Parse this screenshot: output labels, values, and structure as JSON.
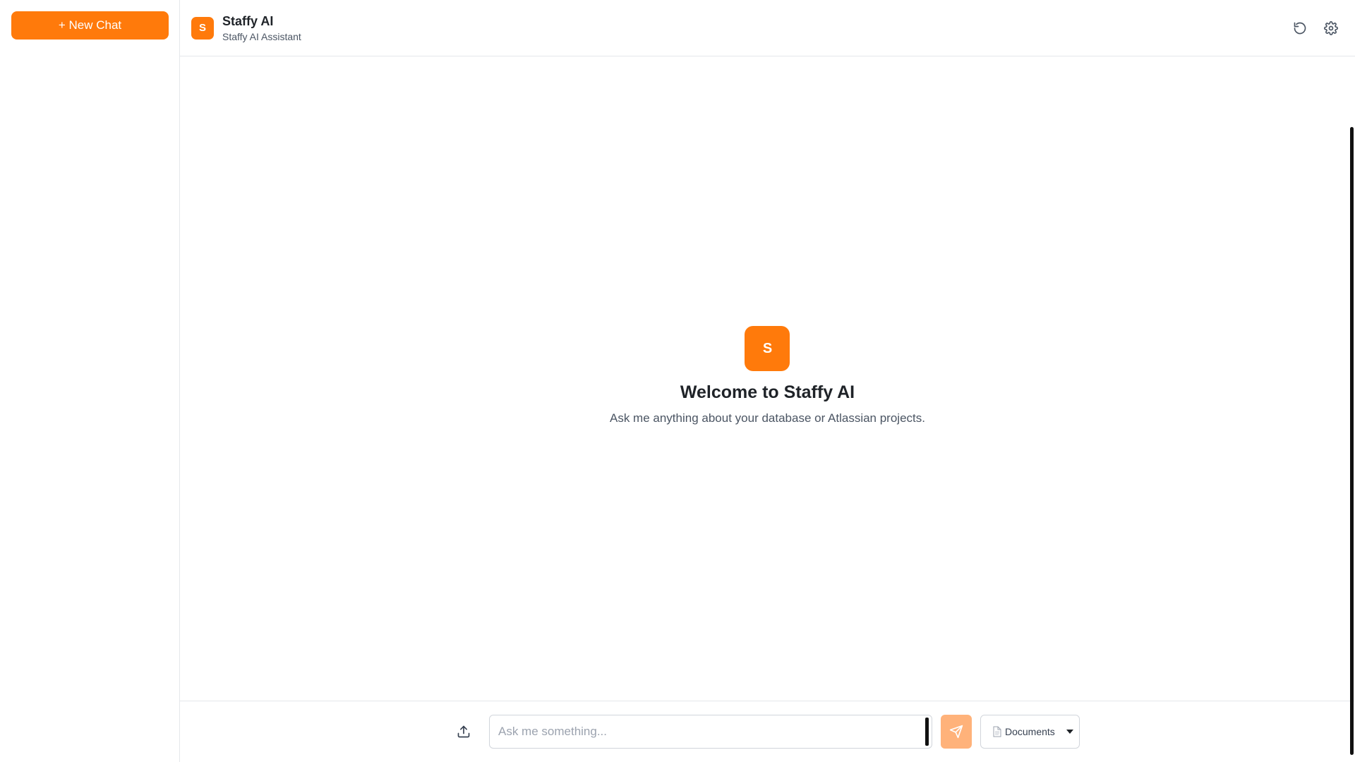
{
  "sidebar": {
    "new_chat_label": "+ New Chat"
  },
  "header": {
    "avatar_letter": "S",
    "title": "Staffy AI",
    "subtitle": "Staffy AI Assistant",
    "actions": [
      {
        "icon": "refresh-icon"
      },
      {
        "icon": "gear-icon"
      }
    ]
  },
  "welcome": {
    "avatar_letter": "S",
    "title": "Welcome to Staffy AI",
    "subtitle": "Ask me anything about your database or Atlassian projects."
  },
  "composer": {
    "upload_icon": "upload-icon",
    "input_placeholder": "Ask me something...",
    "input_value": "",
    "send_icon": "send-icon",
    "source_select": {
      "icon": "document-icon",
      "selected": "Documents"
    }
  },
  "colors": {
    "accent": "#ff7a0b",
    "send_disabled": "#ffb27a",
    "border": "#e5e7eb",
    "muted_text": "#4b5563"
  }
}
